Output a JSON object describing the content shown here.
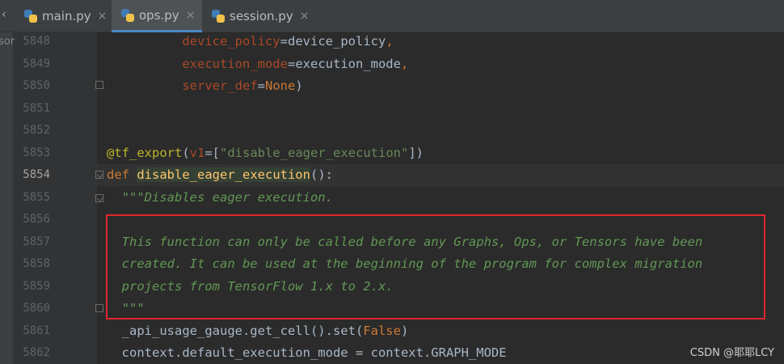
{
  "tabs": [
    {
      "label": "main.py",
      "active": false
    },
    {
      "label": "ops.py",
      "active": true
    },
    {
      "label": "session.py",
      "active": false
    }
  ],
  "side_panel_text": "sor",
  "line_numbers": [
    "5848",
    "5849",
    "5850",
    "5851",
    "5852",
    "5853",
    "5854",
    "5855",
    "5856",
    "5857",
    "5858",
    "5859",
    "5860",
    "5861",
    "5862"
  ],
  "current_line": "5854",
  "code": {
    "l5848": {
      "param": "device_policy",
      "eq": "=",
      "value": "device_policy",
      "comma": ","
    },
    "l5849": {
      "param": "execution_mode",
      "eq": "=",
      "value": "execution_mode",
      "comma": ","
    },
    "l5850": {
      "param": "server_def",
      "eq": "=",
      "value": "None",
      "close": ")"
    },
    "l5853": {
      "decorator": "@tf_export",
      "open": "(",
      "param": "v1",
      "eq": "=[",
      "string": "\"disable_eager_execution\"",
      "close": "])"
    },
    "l5854": {
      "keyword": "def",
      "fn": "disable_eager_execution",
      "rest": "():"
    },
    "l5855": {
      "doc": "\"\"\"Disables eager execution."
    },
    "l5857": {
      "doc": "This function can only be called before any Graphs, Ops, or Tensors have been"
    },
    "l5858": {
      "doc": "created. It can be used at the beginning of the program for complex migration"
    },
    "l5859": {
      "doc": "projects from TensorFlow 1.x to 2.x."
    },
    "l5860": {
      "doc": "\"\"\""
    },
    "l5861": {
      "prefix": "_api_usage_gauge.get_cell().set(",
      "value": "False",
      "close": ")"
    },
    "l5862": {
      "text": "context.default_execution_mode = context.GRAPH_MODE"
    }
  },
  "watermark": "CSDN @耶耶LCY",
  "colors": {
    "highlight_box": "#e0262d",
    "active_tab_underline": "#4a88c7"
  }
}
